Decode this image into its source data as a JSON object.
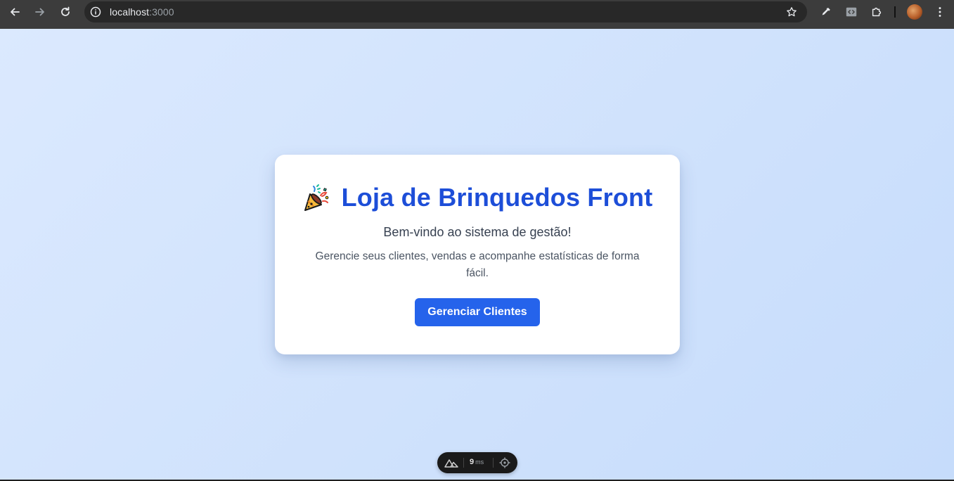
{
  "browser": {
    "url_host": "localhost",
    "url_port": ":3000"
  },
  "main": {
    "title": "Loja de Brinquedos Front",
    "subtitle": "Bem-vindo ao sistema de gestão!",
    "description": "Gerencie seus clientes, vendas e acompanhe estatísticas de forma fácil.",
    "button_label": "Gerenciar Clientes"
  },
  "devtools": {
    "render_time": "9",
    "render_unit": "ms"
  },
  "icons": {
    "title": "party-popper-icon",
    "nav": [
      "back-arrow-icon",
      "forward-arrow-icon",
      "reload-icon"
    ],
    "omnibox": [
      "info-icon",
      "star-icon"
    ],
    "toolbar": [
      "eyedropper-icon",
      "code-extension-icon",
      "puzzle-icon",
      "kebab-menu-icon"
    ],
    "devtools": [
      "nuxt-logo-icon",
      "target-icon"
    ]
  },
  "colors": {
    "title": "#1d4ed8",
    "button": "#2563eb",
    "background_start": "#dbe9fe",
    "background_end": "#c6dcfb",
    "browser_frame": "#3c3c3c"
  }
}
